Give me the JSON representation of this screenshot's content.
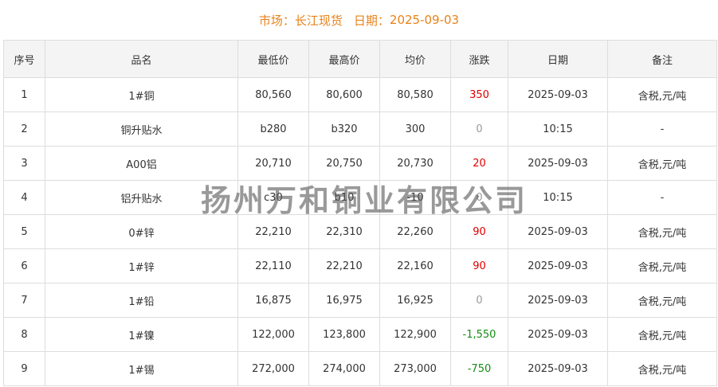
{
  "header": {
    "market_label": "市场：",
    "market_value": "长江现货",
    "date_label": "日期：",
    "date_value": "2025-09-03"
  },
  "columns": [
    "序号",
    "品名",
    "最低价",
    "最高价",
    "均价",
    "涨跌",
    "日期",
    "备注"
  ],
  "rows": [
    {
      "no": "1",
      "name": "1#铜",
      "low": "80,560",
      "high": "80,600",
      "avg": "80,580",
      "change": "350",
      "trend": "up",
      "date": "2025-09-03",
      "note": "含税,元/吨"
    },
    {
      "no": "2",
      "name": "铜升贴水",
      "low": "b280",
      "high": "b320",
      "avg": "300",
      "change": "0",
      "trend": "flat",
      "date": "10:15",
      "note": "-"
    },
    {
      "no": "3",
      "name": "A00铝",
      "low": "20,710",
      "high": "20,750",
      "avg": "20,730",
      "change": "20",
      "trend": "up",
      "date": "2025-09-03",
      "note": "含税,元/吨"
    },
    {
      "no": "4",
      "name": "铝升贴水",
      "low": "c30",
      "high": "b10",
      "avg": "-10",
      "change": "0",
      "trend": "flat",
      "date": "10:15",
      "note": "-"
    },
    {
      "no": "5",
      "name": "0#锌",
      "low": "22,210",
      "high": "22,310",
      "avg": "22,260",
      "change": "90",
      "trend": "up",
      "date": "2025-09-03",
      "note": "含税,元/吨"
    },
    {
      "no": "6",
      "name": "1#锌",
      "low": "22,110",
      "high": "22,210",
      "avg": "22,160",
      "change": "90",
      "trend": "up",
      "date": "2025-09-03",
      "note": "含税,元/吨"
    },
    {
      "no": "7",
      "name": "1#铅",
      "low": "16,875",
      "high": "16,975",
      "avg": "16,925",
      "change": "0",
      "trend": "flat",
      "date": "2025-09-03",
      "note": "含税,元/吨"
    },
    {
      "no": "8",
      "name": "1#镍",
      "low": "122,000",
      "high": "123,800",
      "avg": "122,900",
      "change": "-1,550",
      "trend": "down",
      "date": "2025-09-03",
      "note": "含税,元/吨"
    },
    {
      "no": "9",
      "name": "1#锡",
      "low": "272,000",
      "high": "274,000",
      "avg": "273,000",
      "change": "-750",
      "trend": "down",
      "date": "2025-09-03",
      "note": "含税,元/吨"
    }
  ],
  "colors": {
    "up": "#e00000",
    "down": "#148c14",
    "flat": "#999999",
    "header": "#e8821a"
  },
  "watermark": "扬州万和铜业有限公司"
}
